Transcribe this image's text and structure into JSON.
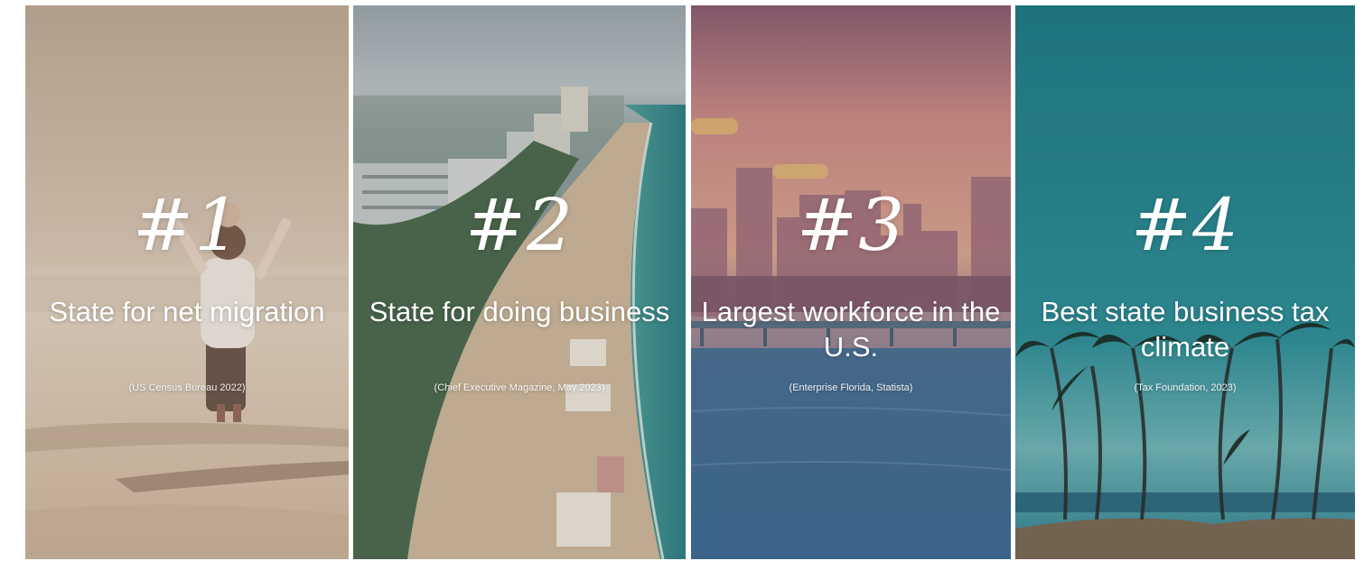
{
  "cards": [
    {
      "rank": "#1",
      "headline": "State for net migration",
      "source": "(US Census Bureau 2022)"
    },
    {
      "rank": "#2",
      "headline": "State for doing business",
      "source": "(Chief Executive Magazine, May 2023)"
    },
    {
      "rank": "#3",
      "headline": "Largest workforce in the U.S.",
      "source": "(Enterprise Florida, Statista)"
    },
    {
      "rank": "#4",
      "headline": "Best state business tax climate",
      "source": "(Tax Foundation, 2023)"
    }
  ],
  "colors": {
    "beach_sky": "#cdb7a0",
    "beach_sand": "#d9c4ad",
    "aerial_ocean": "#5fa9a4",
    "aerial_sand": "#cbb79b",
    "skyline_sky": "#b97a84",
    "skyline_water": "#4f7f9d",
    "palm_sky": "#2e8c97",
    "palm_ground": "#7a6a55",
    "text": "#ffffff"
  }
}
